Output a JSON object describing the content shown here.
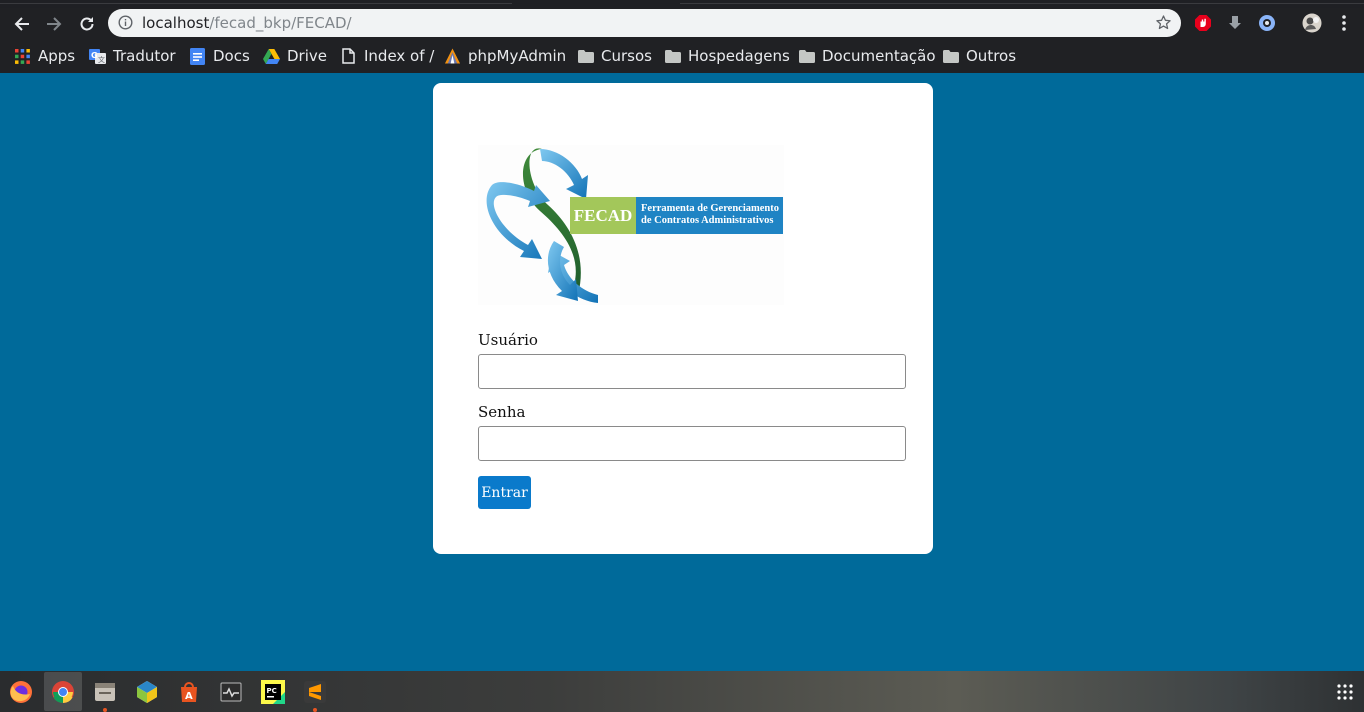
{
  "browser": {
    "url_host": "localhost",
    "url_path": "/fecad_bkp/FECAD/",
    "nav": {
      "back_icon": "back-arrow-icon",
      "forward_icon": "forward-arrow-icon",
      "reload_icon": "reload-icon"
    }
  },
  "bookmarks": [
    {
      "label": "Apps",
      "icon": "apps-grid-icon"
    },
    {
      "label": "Tradutor",
      "icon": "translate-icon"
    },
    {
      "label": "Docs",
      "icon": "docs-icon"
    },
    {
      "label": "Drive",
      "icon": "drive-icon"
    },
    {
      "label": "Index of /",
      "icon": "page-icon"
    },
    {
      "label": "phpMyAdmin",
      "icon": "phpmyadmin-icon"
    },
    {
      "label": "Cursos",
      "icon": "folder-icon"
    },
    {
      "label": "Hospedagens",
      "icon": "folder-icon"
    },
    {
      "label": "Documentação",
      "icon": "folder-icon"
    },
    {
      "label": "Outros",
      "icon": "folder-icon"
    }
  ],
  "logo": {
    "acronym": "FECAD",
    "line1": "Ferramenta de Gerenciamento",
    "line2": "de Contratos Administrativos"
  },
  "login": {
    "user_label": "Usuário",
    "user_value": "",
    "password_label": "Senha",
    "password_value": "",
    "submit_label": "Entrar"
  },
  "colors": {
    "page_background": "#006a9a",
    "button": "#0a7acb",
    "logo_green": "#a3c75a",
    "logo_blue": "#1f84c4"
  },
  "taskbar": [
    {
      "app": "firefox-icon"
    },
    {
      "app": "chrome-icon",
      "active": true
    },
    {
      "app": "files-icon"
    },
    {
      "app": "virtualbox-icon"
    },
    {
      "app": "software-center-icon"
    },
    {
      "app": "system-monitor-icon"
    },
    {
      "app": "pycharm-icon"
    },
    {
      "app": "sublime-text-icon"
    },
    {
      "app": "show-applications-icon"
    }
  ]
}
